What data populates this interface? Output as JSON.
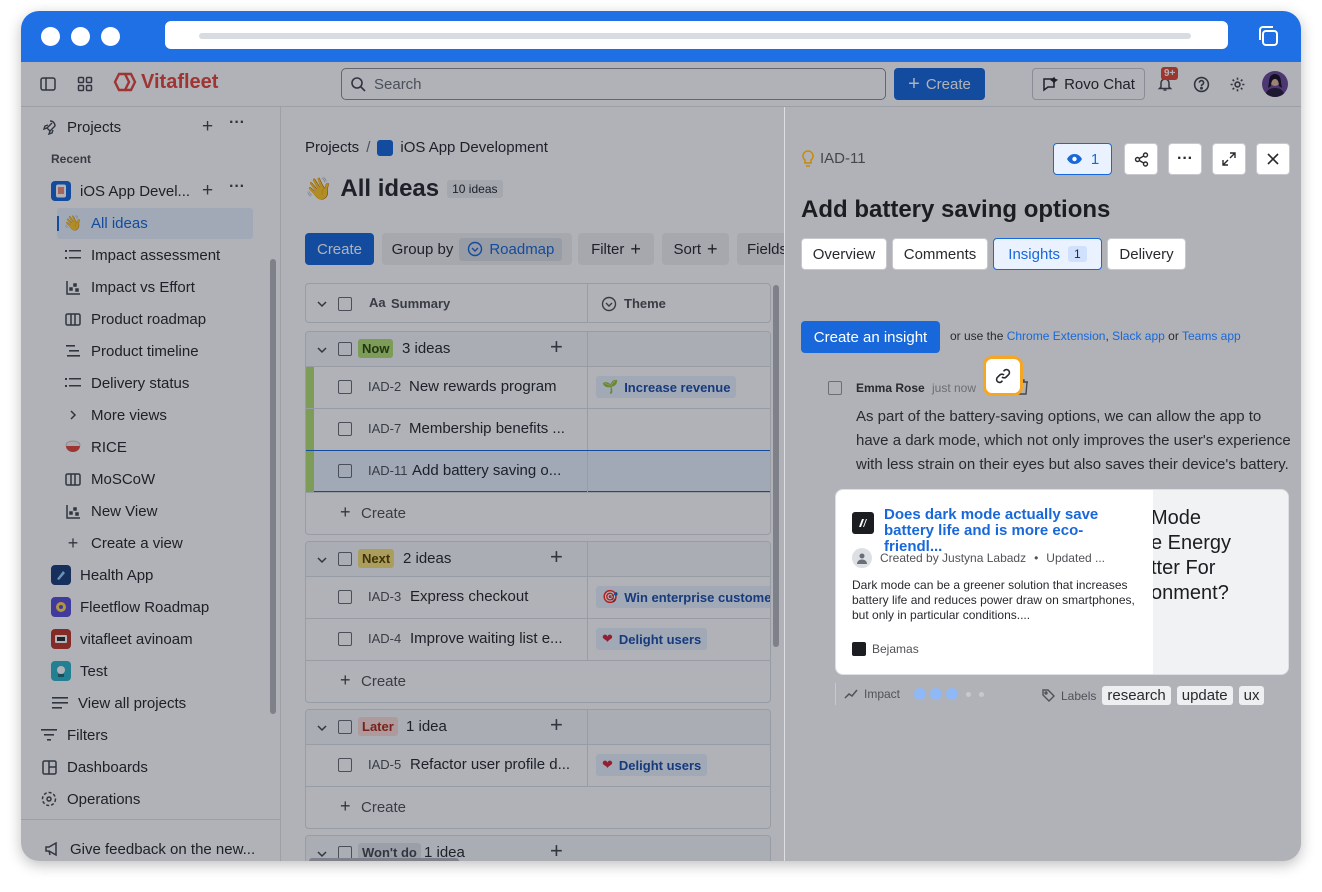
{
  "topnav": {
    "brand": "Vitafleet",
    "search_placeholder": "Search",
    "create_label": "Create",
    "rovo_label": "Rovo Chat",
    "notifications_badge": "9+"
  },
  "sidebar": {
    "projects_label": "Projects",
    "recent_label": "Recent",
    "project_ios": "iOS App Devel...",
    "views": [
      "All ideas",
      "Impact assessment",
      "Impact vs Effort",
      "Product roadmap",
      "Product timeline",
      "Delivery status",
      "More views",
      "RICE",
      "MoSCoW",
      "New View",
      "Create a view"
    ],
    "projects": [
      "Health App",
      "Fleetflow Roadmap",
      "vitafleet avinoam",
      "Test"
    ],
    "view_all_projects": "View all projects",
    "filters": "Filters",
    "dashboards": "Dashboards",
    "operations": "Operations",
    "feedback": "Give feedback on the new..."
  },
  "main": {
    "breadcrumb_root": "Projects",
    "breadcrumb_sep": "/",
    "breadcrumb_project": "iOS App Development",
    "title": "All ideas",
    "count": "10 ideas",
    "toolbar": {
      "create": "Create",
      "group_by": "Group by",
      "group_value": "Roadmap",
      "filter": "Filter",
      "sort": "Sort",
      "fields": "Fields"
    },
    "columns": {
      "summary": "Summary",
      "theme": "Theme",
      "summary_prefix": "Aa"
    },
    "groups": [
      {
        "name": "Now",
        "count": "3 ideas",
        "rows": [
          {
            "key": "IAD-2",
            "summary": "New rewards program",
            "theme": "Increase revenue"
          },
          {
            "key": "IAD-7",
            "summary": "Membership benefits ...",
            "theme": ""
          },
          {
            "key": "IAD-11",
            "summary": "Add battery saving o...",
            "theme": ""
          }
        ]
      },
      {
        "name": "Next",
        "count": "2 ideas",
        "rows": [
          {
            "key": "IAD-3",
            "summary": "Express checkout",
            "theme": "Win enterprise customers"
          },
          {
            "key": "IAD-4",
            "summary": "Improve waiting list e...",
            "theme": "Delight users"
          }
        ]
      },
      {
        "name": "Later",
        "count": "1 idea",
        "rows": [
          {
            "key": "IAD-5",
            "summary": "Refactor user profile d...",
            "theme": "Delight users"
          }
        ]
      },
      {
        "name": "Won't do",
        "count": "1 idea",
        "rows": []
      }
    ],
    "create_row": "Create"
  },
  "panel": {
    "key": "IAD-11",
    "watchers": "1",
    "title": "Add battery saving options",
    "tabs": {
      "overview": "Overview",
      "comments": "Comments",
      "insights": "Insights",
      "insights_count": "1",
      "delivery": "Delivery"
    },
    "create_insight": "Create an insight",
    "or_use": "or use the",
    "chrome_ext": "Chrome Extension",
    "comma": ",",
    "slack": "Slack app",
    "or": "or",
    "teams": "Teams app",
    "insight": {
      "author": "Emma Rose",
      "time": "just now",
      "text": "As part of the battery-saving options, we can allow the app to have a dark mode, which not only improves the user's experience with less strain on their eyes but also saves their device's battery.",
      "card_title": "Does dark mode actually save battery life and is more eco-friendl...",
      "card_meta_by": "Created by Justyna Labadz",
      "card_meta_dot": "•",
      "card_meta_updated": "Updated ...",
      "card_desc": "Dark mode can be a greener solution that increases battery life and reduces power draw on smartphones, but only in particular conditions....",
      "card_source": "Bejamas",
      "card_image_text": [
        "Mode",
        "e Energy",
        "tter For",
        "onment?"
      ],
      "impact_label": "Impact",
      "labels_label": "Labels",
      "labels": [
        "research",
        "update",
        "ux"
      ]
    }
  }
}
